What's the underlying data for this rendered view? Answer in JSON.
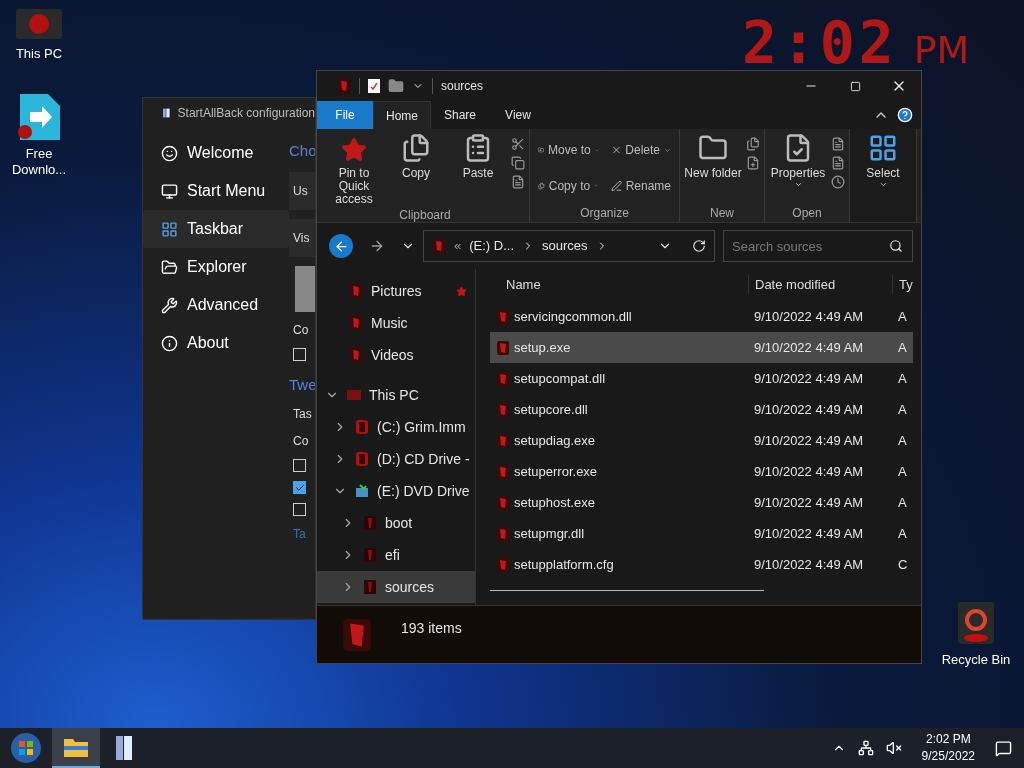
{
  "desktop_icons": [
    {
      "label": "This PC",
      "kind": "pc"
    },
    {
      "label": "Free Downlo...",
      "kind": "download"
    }
  ],
  "recycle_bin": {
    "label": "Recycle Bin"
  },
  "desktop_clock": {
    "time": "2:02",
    "period": "PM"
  },
  "config_window": {
    "title": "StartAllBack configuration",
    "sidebar": [
      {
        "label": "Welcome",
        "selected": false
      },
      {
        "label": "Start Menu",
        "selected": false
      },
      {
        "label": "Taskbar",
        "selected": true
      },
      {
        "label": "Explorer",
        "selected": false
      },
      {
        "label": "Advanced",
        "selected": false
      },
      {
        "label": "About",
        "selected": false
      }
    ],
    "content": [
      {
        "kind": "heading",
        "text": "Cho"
      },
      {
        "kind": "card",
        "text": "Us"
      },
      {
        "kind": "card",
        "text": "Vis"
      },
      {
        "kind": "image"
      },
      {
        "kind": "text",
        "text": "Co"
      },
      {
        "kind": "checkbox",
        "checked": false
      },
      {
        "kind": "heading",
        "text": "Twe"
      },
      {
        "kind": "text",
        "text": "Tas"
      },
      {
        "kind": "text",
        "text": "Co"
      },
      {
        "kind": "checkbox",
        "checked": false
      },
      {
        "kind": "checkbox",
        "checked": true
      },
      {
        "kind": "checkbox",
        "checked": false
      },
      {
        "kind": "link",
        "text": "Ta"
      }
    ]
  },
  "explorer": {
    "title": "sources",
    "tabs": [
      {
        "label": "File",
        "kind": "file",
        "selected": false
      },
      {
        "label": "Home",
        "kind": "tab",
        "selected": true
      },
      {
        "label": "Share",
        "kind": "tab",
        "selected": false
      },
      {
        "label": "View",
        "kind": "tab",
        "selected": false
      }
    ],
    "ribbon_groups": [
      {
        "label": "Clipboard",
        "buttons": [
          {
            "label": "Pin to Quick access",
            "dropdown": false
          },
          {
            "label": "Copy",
            "dropdown": false
          },
          {
            "label": "Paste",
            "dropdown": false
          }
        ]
      },
      {
        "label": "Organize",
        "rows": [
          {
            "label": "Move to",
            "dropdown": true
          },
          {
            "label": "Delete",
            "dropdown": true
          },
          {
            "label": "Copy to",
            "dropdown": true
          },
          {
            "label": "Rename",
            "dropdown": false
          }
        ]
      },
      {
        "label": "New",
        "buttons": [
          {
            "label": "New folder",
            "dropdown": false
          }
        ]
      },
      {
        "label": "Open",
        "buttons": [
          {
            "label": "Properties",
            "dropdown": true
          }
        ]
      },
      {
        "buttons": [
          {
            "label": "Select",
            "dropdown": true
          }
        ]
      }
    ],
    "address": {
      "crumbs": [
        "«",
        "(E:) D...",
        "sources"
      ]
    },
    "search": {
      "placeholder": "Search sources"
    },
    "nav": [
      {
        "label": "Pictures",
        "pinned": true,
        "selected": false,
        "kind": "library"
      },
      {
        "label": "Music",
        "pinned": false,
        "selected": false,
        "kind": "library"
      },
      {
        "label": "Videos",
        "pinned": false,
        "selected": false,
        "kind": "library"
      },
      {
        "label": "This PC",
        "expanded": true,
        "selected": false,
        "kind": "pc",
        "children": [
          {
            "label": "(C:) Grim.Imm",
            "expanded": false,
            "selected": false,
            "kind": "drive"
          },
          {
            "label": "(D:) CD Drive -",
            "expanded": false,
            "selected": false,
            "kind": "drive"
          },
          {
            "label": "(E:) DVD Drive",
            "expanded": true,
            "selected": false,
            "kind": "dvd",
            "children": [
              {
                "label": "boot",
                "expanded": false,
                "selected": false,
                "kind": "folder"
              },
              {
                "label": "efi",
                "expanded": false,
                "selected": false,
                "kind": "folder"
              },
              {
                "label": "sources",
                "expanded": false,
                "selected": true,
                "kind": "folder"
              }
            ]
          }
        ]
      }
    ],
    "columns": [
      "Name",
      "Date modified",
      "Ty"
    ],
    "rows": [
      {
        "name": "servicingcommon.dll",
        "date": "9/10/2022 4:49 AM",
        "type": "A",
        "selected": false
      },
      {
        "name": "setup.exe",
        "date": "9/10/2022 4:49 AM",
        "type": "A",
        "selected": true
      },
      {
        "name": "setupcompat.dll",
        "date": "9/10/2022 4:49 AM",
        "type": "A",
        "selected": false
      },
      {
        "name": "setupcore.dll",
        "date": "9/10/2022 4:49 AM",
        "type": "A",
        "selected": false
      },
      {
        "name": "setupdiag.exe",
        "date": "9/10/2022 4:49 AM",
        "type": "A",
        "selected": false
      },
      {
        "name": "setuperror.exe",
        "date": "9/10/2022 4:49 AM",
        "type": "A",
        "selected": false
      },
      {
        "name": "setuphost.exe",
        "date": "9/10/2022 4:49 AM",
        "type": "A",
        "selected": false
      },
      {
        "name": "setupmgr.dll",
        "date": "9/10/2022 4:49 AM",
        "type": "A",
        "selected": false
      },
      {
        "name": "setupplatform.cfg",
        "date": "9/10/2022 4:49 AM",
        "type": "C",
        "selected": false
      }
    ],
    "status": "193 items"
  },
  "taskbar": {
    "apps": [
      {
        "kind": "explorer",
        "active": true
      },
      {
        "kind": "config",
        "active": false
      }
    ],
    "time": "2:02 PM",
    "date": "9/25/2022"
  }
}
